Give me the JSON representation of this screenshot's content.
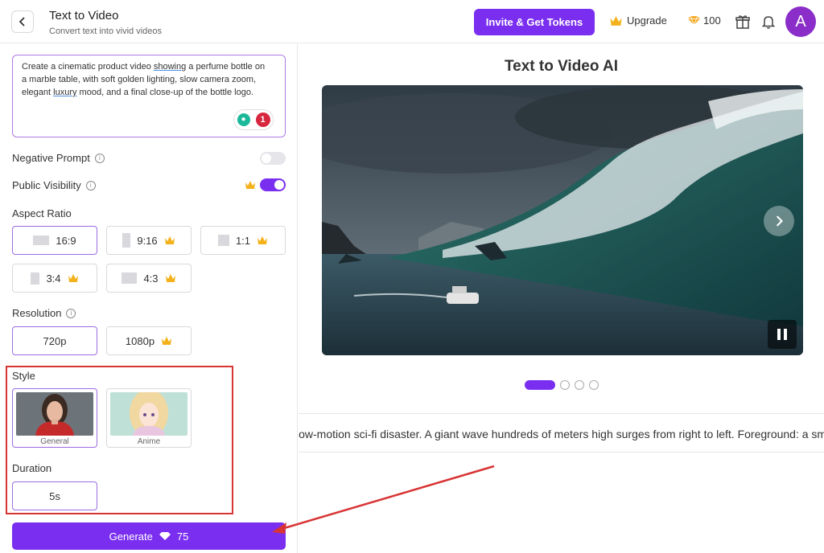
{
  "header": {
    "title": "Text to Video",
    "subtitle": "Convert text into vivid videos",
    "invite_label": "Invite & Get Tokens",
    "upgrade_label": "Upgrade",
    "token_count": "100",
    "avatar_letter": "A"
  },
  "prompt": {
    "text_line1_a": "Create a cinematic product video ",
    "text_line1_b": "showing",
    "text_line1_c": " a perfume bottle on",
    "text_line2": "a marble table, with soft golden lighting, slow camera zoom,",
    "text_line3_a": "elegant ",
    "text_line3_b": "luxury",
    "text_line3_c": " mood, and a final close-up of the bottle logo.",
    "issue_count": "1"
  },
  "settings": {
    "negative_prompt_label": "Negative Prompt",
    "public_visibility_label": "Public Visibility",
    "aspect_ratio_label": "Aspect Ratio",
    "aspect_ratios": [
      "16:9",
      "9:16",
      "1:1",
      "3:4",
      "4:3"
    ],
    "resolution_label": "Resolution",
    "resolutions": [
      "720p",
      "1080p"
    ],
    "style_label": "Style",
    "styles": [
      "General",
      "Anime"
    ],
    "duration_label": "Duration",
    "duration_value": "5s",
    "generate_label": "Generate",
    "generate_cost": "75"
  },
  "main": {
    "title": "Text to Video AI",
    "scrolling_prompt": "low-motion sci-fi disaster. A giant wave hundreds of meters high surges from right to left. Foreground: a small ro"
  },
  "colors": {
    "accent": "#7a2ff0",
    "annotation_red": "#d83434"
  }
}
